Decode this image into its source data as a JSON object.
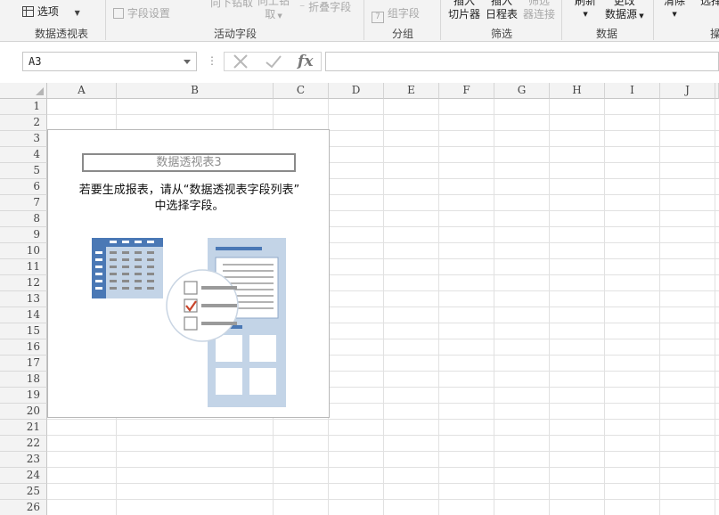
{
  "ribbon": {
    "options_label": "选项",
    "field_settings_label": "字段设置",
    "drill_down_label": "向下钻取",
    "drill_up_label_line1": "向上钻",
    "drill_up_label_line2": "取",
    "collapse_field_label": "折叠字段",
    "group_field_label": "组字段",
    "insert_slicer_line1": "插入",
    "insert_slicer_line2": "切片器",
    "insert_timeline_line1": "插入",
    "insert_timeline_line2": "日程表",
    "filter_conn_line1": "筛选",
    "filter_conn_line2": "器连接",
    "refresh_label": "刷新",
    "change_source_line1": "更改",
    "change_source_line2": "数据源",
    "clear_label": "清除",
    "select_label": "选择",
    "groups": {
      "pivot_table": "数据透视表",
      "active_field": "活动字段",
      "group": "分组",
      "filter": "筛选",
      "data": "数据",
      "actions": "操"
    }
  },
  "formula_bar": {
    "name_box_value": "A3",
    "cancel_icon": "cross-icon",
    "enter_icon": "check-icon",
    "function_label": "fx",
    "formula_value": ""
  },
  "sheet": {
    "columns": [
      "A",
      "B",
      "C",
      "D",
      "E",
      "F",
      "G",
      "H",
      "I",
      "J"
    ],
    "rows": [
      "1",
      "2",
      "3",
      "4",
      "5",
      "6",
      "7",
      "8",
      "9",
      "10",
      "11",
      "12",
      "13",
      "14",
      "15",
      "16",
      "17",
      "18",
      "19",
      "20",
      "21",
      "22",
      "23",
      "24",
      "25",
      "26"
    ]
  },
  "pivot": {
    "title": "数据透视表3",
    "message_line1": "若要生成报表，请从“数据透视表字段列表”",
    "message_line2": "中选择字段。"
  },
  "colors": {
    "illustration_blue": "#4a78b5",
    "illustration_light": "#c3d4e7",
    "check_red": "#c8442a"
  }
}
